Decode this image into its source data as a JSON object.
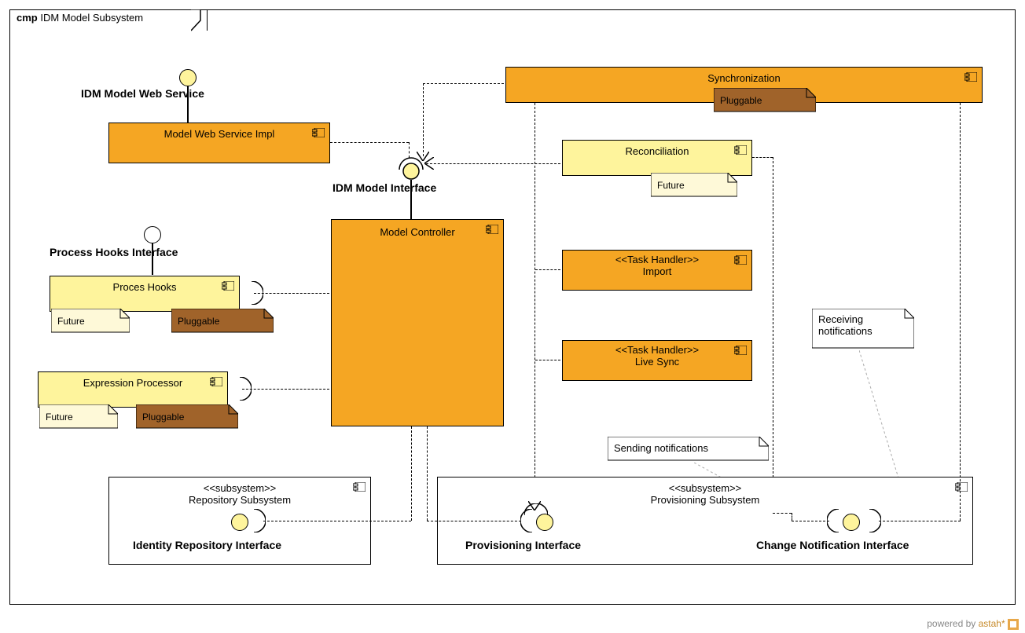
{
  "frame": {
    "kind": "cmp",
    "title": "IDM Model Subsystem"
  },
  "interfaces": {
    "webService": "IDM Model Web Service",
    "processHooks": "Process Hooks Interface",
    "modelInterface": "IDM Model Interface",
    "identityRepo": "Identity Repository Interface",
    "provisioning": "Provisioning Interface",
    "changeNotification": "Change Notification Interface"
  },
  "components": {
    "modelWebServiceImpl": "Model Web Service Impl",
    "modelController": "Model Controller",
    "processHooks": "Proces Hooks",
    "expressionProcessor": "Expression Processor",
    "synchronization": "Synchronization",
    "reconciliation": "Reconciliation",
    "import": {
      "stereotype": "<<Task Handler>>",
      "name": "Import"
    },
    "liveSync": {
      "stereotype": "<<Task Handler>>",
      "name": "Live Sync"
    }
  },
  "subsystems": {
    "repository": {
      "stereotype": "<<subsystem>>",
      "name": "Repository Subsystem"
    },
    "provisioning": {
      "stereotype": "<<subsystem>>",
      "name": "Provisioning Subsystem"
    }
  },
  "notes": {
    "pluggable": "Pluggable",
    "future": "Future",
    "sending": "Sending notifications",
    "receiving": "Receiving\nnotifications"
  },
  "footer": {
    "text": "powered by ",
    "brand": "astah*"
  }
}
